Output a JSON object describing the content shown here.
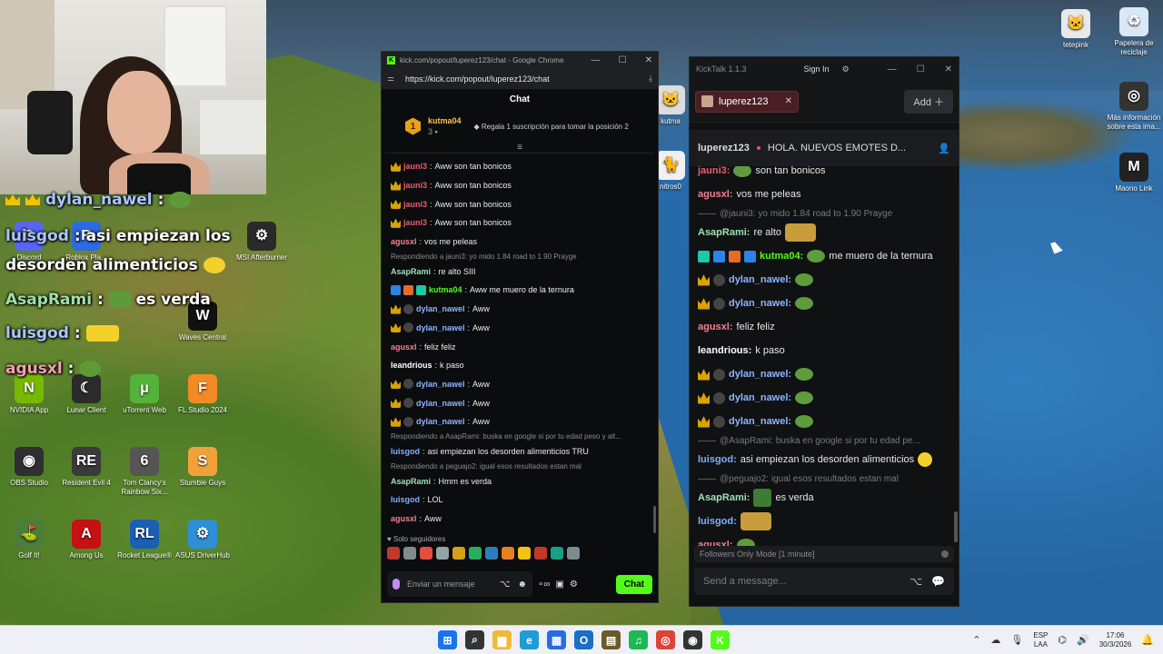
{
  "desktop_icons": [
    {
      "name": "discord-icon",
      "label": "Discord",
      "color": "#5865f2",
      "glyph": "D"
    },
    {
      "name": "roblox-icon",
      "label": "Roblox Pla...",
      "color": "#2c6be0",
      "glyph": "R"
    },
    {
      "name": "msi-icon",
      "label": "MSI Afterburner",
      "color": "#2a2a2a",
      "glyph": "⚙"
    },
    {
      "name": "waves-icon",
      "label": "Waves Central",
      "color": "#111111",
      "glyph": "W"
    },
    {
      "name": "nvidia-icon",
      "label": "NVIDIA App",
      "color": "#76b900",
      "glyph": "N"
    },
    {
      "name": "lunar-icon",
      "label": "Lunar Client",
      "color": "#2b2b2b",
      "glyph": "☾"
    },
    {
      "name": "utorrent-icon",
      "label": "uTorrent Web",
      "color": "#55b23a",
      "glyph": "μ"
    },
    {
      "name": "flstudio-icon",
      "label": "FL Studio 2024",
      "color": "#f28b24",
      "glyph": "F"
    },
    {
      "name": "obs-icon",
      "label": "OBS Studio",
      "color": "#302e31",
      "glyph": "◉"
    },
    {
      "name": "residentevil-icon",
      "label": "Resident Evil 4",
      "color": "#3a3a3a",
      "glyph": "RE"
    },
    {
      "name": "rainbowsix-icon",
      "label": "Tom Clancy's Rainbow Six...",
      "color": "#555555",
      "glyph": "6"
    },
    {
      "name": "stumble-icon",
      "label": "Stumble Guys",
      "color": "#f2a13a",
      "glyph": "S"
    },
    {
      "name": "golfit-icon",
      "label": "Golf It!",
      "color": "#4e7d3a",
      "glyph": "⛳"
    },
    {
      "name": "amongus-icon",
      "label": "Among Us",
      "color": "#c51111",
      "glyph": "A"
    },
    {
      "name": "rocketleague-icon",
      "label": "Rocket League®",
      "color": "#1b5fb5",
      "glyph": "RL"
    },
    {
      "name": "asus-icon",
      "label": "ASUS DriverHub",
      "color": "#2d8fd5",
      "glyph": "⚙"
    },
    {
      "name": "tetepink-icon",
      "label": "tetepink",
      "color": "#e9e9e9",
      "glyph": "🐱"
    },
    {
      "name": "recycle-bin-icon",
      "label": "Papelera de reciclaje",
      "color": "#d8e9f5",
      "glyph": "♻"
    },
    {
      "name": "info-icon",
      "label": "Más información sobre esta ima...",
      "color": "#333333",
      "glyph": "◎"
    },
    {
      "name": "maono-icon",
      "label": "Maono Link",
      "color": "#222222",
      "glyph": "M"
    },
    {
      "name": "kutma-icon",
      "label": "kutma",
      "color": "#dddddd",
      "glyph": "🐱"
    },
    {
      "name": "monitores-icon",
      "label": "nitros0",
      "color": "#f0f0f0",
      "glyph": "🐈"
    }
  ],
  "overlay": {
    "l1_name": "dylan_nawel",
    "l2_name": "luisgod",
    "l2_text": "asi empiezan los",
    "l3_text": "desorden alimenticios",
    "l4_name": "AsapRami",
    "l4_text": "es verda",
    "l5_name": "luisgod",
    "l6_name": "agusxl",
    "sep": ":"
  },
  "chrome": {
    "title": "kick.com/popout/luperez123/chat - Google Chrome",
    "url": "https://kick.com/popout/luperez123/chat",
    "header": "Chat",
    "pin_rank": "1",
    "pin_user": "kutma04",
    "pin_count": "3",
    "pin_tip": "Regala 1 suscripción para tomar la posición 2",
    "followers": "Solo seguidores",
    "input_placeholder": "Enviar un mensaje",
    "send_label": "Chat"
  },
  "kick_messages": [
    {
      "user": "jauni3",
      "color": "#f05b6d",
      "text": "Aww son tan bonicos",
      "badges": [
        "b-crown"
      ]
    },
    {
      "user": "jauni3",
      "color": "#f05b6d",
      "text": "Aww son tan bonicos",
      "badges": [
        "b-crown"
      ]
    },
    {
      "user": "jauni3",
      "color": "#f05b6d",
      "text": "Aww son tan bonicos",
      "badges": [
        "b-crown"
      ]
    },
    {
      "user": "jauni3",
      "color": "#f05b6d",
      "text": "Aww son tan bonicos",
      "badges": [
        "b-crown"
      ]
    },
    {
      "user": "agusxl",
      "color": "#f77f93",
      "text": "vos me peleas",
      "badges": []
    },
    {
      "reply": "Respondiendo a jauni3: yo mido 1.84 road to 1.90 Prayge"
    },
    {
      "user": "AsapRami",
      "color": "#9fe1b3",
      "text": "re alto SIII",
      "badges": []
    },
    {
      "user": "kutma04",
      "color": "#53fc18",
      "text": "Aww me muero de la ternura",
      "badges": [
        "b-blue",
        "b-orange",
        "b-teal"
      ]
    },
    {
      "user": "dylan_nawel",
      "color": "#8fb5ff",
      "text": "Aww",
      "badges": [
        "b-crown",
        "b-glass"
      ]
    },
    {
      "user": "dylan_nawel",
      "color": "#8fb5ff",
      "text": "Aww",
      "badges": [
        "b-crown",
        "b-glass"
      ]
    },
    {
      "user": "agusxl",
      "color": "#f77f93",
      "text": "feliz feliz",
      "badges": []
    },
    {
      "user": "leandrious",
      "color": "#ffffff",
      "text": "k paso",
      "badges": []
    },
    {
      "user": "dylan_nawel",
      "color": "#8fb5ff",
      "text": "Aww",
      "badges": [
        "b-crown",
        "b-glass"
      ]
    },
    {
      "user": "dylan_nawel",
      "color": "#8fb5ff",
      "text": "Aww",
      "badges": [
        "b-crown",
        "b-glass"
      ]
    },
    {
      "user": "dylan_nawel",
      "color": "#8fb5ff",
      "text": "Aww",
      "badges": [
        "b-crown",
        "b-glass"
      ]
    },
    {
      "reply": "Respondiendo a AsapRami: buska en google si por tu edad peso y alt..."
    },
    {
      "user": "luisgod",
      "color": "#7fb0ff",
      "text": "asi empiezan los desorden alimenticios TRU",
      "badges": []
    },
    {
      "reply": "Respondiendo a peguajo2: igual esos resultados estan mal"
    },
    {
      "user": "AsapRami",
      "color": "#9fe1b3",
      "text": "Hmm es verda",
      "badges": []
    },
    {
      "user": "luisgod",
      "color": "#7fb0ff",
      "text": "LOL",
      "badges": []
    },
    {
      "user": "agusxl",
      "color": "#f77f93",
      "text": "Aww",
      "badges": []
    }
  ],
  "kicktalk": {
    "app_title": "KickTalk 1.1.3",
    "signin": "Sign In",
    "tab_label": "luperez123",
    "add_label": "Add",
    "channel": "luperez123",
    "stream_title": "HOLA. NUEVOS EMOTES D...",
    "followers_mode": "Followers Only Mode [1 minute]",
    "send_placeholder": "Send a message..."
  },
  "kicktalk_messages": [
    {
      "user": "jauni3:",
      "color": "#f05b6d",
      "text": "son tan bonicos",
      "emote": "emo",
      "partial": true
    },
    {
      "user": "agusxl:",
      "color": "#f77f93",
      "text": "vos me peleas"
    },
    {
      "reply": "@jauni3: yo mido 1.84 road to 1.90 Prayge"
    },
    {
      "user": "AsapRami:",
      "color": "#9fe1b3",
      "text": "re alto",
      "emote_after": "big"
    },
    {
      "user": "kutma04:",
      "color": "#53fc18",
      "text": "me muero de la ternura",
      "emote": "emo",
      "badges": [
        "b-teal",
        "b-blue",
        "b-orange",
        "b-blue"
      ]
    },
    {
      "user": "dylan_nawel:",
      "color": "#8fb5ff",
      "text": "",
      "emote": "emo",
      "badges": [
        "b-crown",
        "b-glass"
      ]
    },
    {
      "user": "dylan_nawel:",
      "color": "#8fb5ff",
      "text": "",
      "emote": "emo",
      "badges": [
        "b-crown",
        "b-glass"
      ]
    },
    {
      "user": "agusxl:",
      "color": "#f77f93",
      "text": "feliz feliz"
    },
    {
      "user": "leandrious:",
      "color": "#ffffff",
      "text": "k paso"
    },
    {
      "user": "dylan_nawel:",
      "color": "#8fb5ff",
      "text": "",
      "emote": "emo",
      "badges": [
        "b-crown",
        "b-glass"
      ]
    },
    {
      "user": "dylan_nawel:",
      "color": "#8fb5ff",
      "text": "",
      "emote": "emo",
      "badges": [
        "b-crown",
        "b-glass"
      ]
    },
    {
      "user": "dylan_nawel:",
      "color": "#8fb5ff",
      "text": "",
      "emote": "emo",
      "badges": [
        "b-crown",
        "b-glass"
      ]
    },
    {
      "reply": "@AsapRami: buska en google si por tu edad pe..."
    },
    {
      "user": "luisgod:",
      "color": "#7fb0ff",
      "text": "asi empiezan los desorden alimenticios",
      "emote_after": "yel"
    },
    {
      "reply": "@peguajo2: igual esos resultados estan mal"
    },
    {
      "user": "AsapRami:",
      "color": "#9fe1b3",
      "text": "es verda",
      "emote": "sq"
    },
    {
      "user": "luisgod:",
      "color": "#7fb0ff",
      "text": "",
      "emote": "big"
    },
    {
      "user": "agusxl:",
      "color": "#f77f93",
      "text": "",
      "emote": "emo"
    }
  ],
  "taskbar": {
    "lang1": "ESP",
    "lang2": "LAA",
    "time": "17:06",
    "date": "30/3/2026",
    "apps": [
      {
        "name": "start-icon",
        "glyph": "⊞",
        "color": "#1a73e8"
      },
      {
        "name": "search-icon",
        "glyph": "⌕",
        "color": "#333333"
      },
      {
        "name": "file-explorer-icon",
        "glyph": "▆",
        "color": "#f2b936"
      },
      {
        "name": "edge-icon",
        "glyph": "e",
        "color": "#1f9bd7"
      },
      {
        "name": "store-icon",
        "glyph": "▦",
        "color": "#2b6be0"
      },
      {
        "name": "outlook-icon",
        "glyph": "O",
        "color": "#1a6ec4"
      },
      {
        "name": "minecraft-icon",
        "glyph": "▤",
        "color": "#6b5a2a"
      },
      {
        "name": "spotify-icon",
        "glyph": "♫",
        "color": "#1db954"
      },
      {
        "name": "chrome-icon",
        "glyph": "◎",
        "color": "#db4437"
      },
      {
        "name": "obs-taskbar-icon",
        "glyph": "◉",
        "color": "#333333"
      },
      {
        "name": "kick-taskbar-icon",
        "glyph": "K",
        "color": "#53fc18"
      }
    ]
  }
}
